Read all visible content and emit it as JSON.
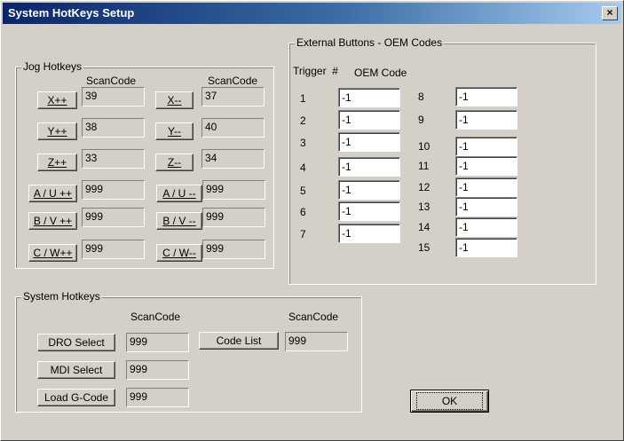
{
  "window": {
    "title": "System HotKeys Setup",
    "close_glyph": "×",
    "close_icon": "close-icon"
  },
  "jog": {
    "legend": "Jog Hotkeys",
    "scancode_header_left": "ScanCode",
    "scancode_header_right": "ScanCode",
    "rows": [
      {
        "plus_label": "X++",
        "plus_code": "39",
        "minus_label": "X--",
        "minus_code": "37"
      },
      {
        "plus_label": "Y++",
        "plus_code": "38",
        "minus_label": "Y--",
        "minus_code": "40"
      },
      {
        "plus_label": "Z++",
        "plus_code": "33",
        "minus_label": "Z--",
        "minus_code": "34"
      },
      {
        "plus_label": "A / U ++",
        "plus_code": "999",
        "minus_label": "A / U --",
        "minus_code": "999"
      },
      {
        "plus_label": "B / V ++",
        "plus_code": "999",
        "minus_label": "B / V --",
        "minus_code": "999"
      },
      {
        "plus_label": "C / W++",
        "plus_code": "999",
        "minus_label": "C / W--",
        "minus_code": "999"
      }
    ]
  },
  "external": {
    "legend": "External Buttons - OEM Codes",
    "trigger_header": "Trigger  #",
    "oem_header": "OEM Code",
    "left": [
      {
        "num": "1",
        "value": "-1"
      },
      {
        "num": "2",
        "value": "-1"
      },
      {
        "num": "3",
        "value": "-1"
      },
      {
        "num": "4",
        "value": "-1"
      },
      {
        "num": "5",
        "value": "-1"
      },
      {
        "num": "6",
        "value": "-1"
      },
      {
        "num": "7",
        "value": "-1"
      }
    ],
    "right": [
      {
        "num": "8",
        "value": "-1"
      },
      {
        "num": "9",
        "value": "-1"
      },
      {
        "num": "10",
        "value": "-1"
      },
      {
        "num": "11",
        "value": "-1"
      },
      {
        "num": "12",
        "value": "-1"
      },
      {
        "num": "13",
        "value": "-1"
      },
      {
        "num": "14",
        "value": "-1"
      },
      {
        "num": "15",
        "value": "-1"
      }
    ]
  },
  "system": {
    "legend": "System Hotkeys",
    "scancode_header_left": "ScanCode",
    "scancode_header_right": "ScanCode",
    "dro_label": "DRO Select",
    "dro_code": "999",
    "mdi_label": "MDI Select",
    "mdi_code": "999",
    "load_label": "Load G-Code",
    "load_code": "999",
    "codelist_label": "Code List",
    "codelist_code": "999"
  },
  "ok_label": "OK"
}
